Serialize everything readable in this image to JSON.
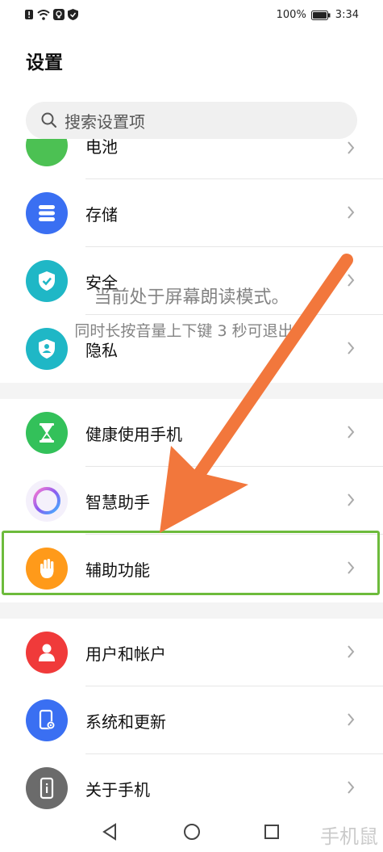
{
  "status_bar": {
    "battery": "100%",
    "time": "3:34"
  },
  "header": {
    "title": "设置"
  },
  "search": {
    "placeholder": "搜索设置项"
  },
  "items": [
    {
      "label": "电池",
      "color": "#4cc153"
    },
    {
      "label": "存储",
      "color": "#3a6ff2"
    },
    {
      "label": "安全",
      "color": "#1fb7c6"
    },
    {
      "label": "隐私",
      "color": "#1fb7c6"
    },
    {
      "label": "健康使用手机",
      "color": "#33c15a"
    },
    {
      "label": "智慧助手",
      "color": "#8a5cf0"
    },
    {
      "label": "辅助功能",
      "color": "#ff9a1a"
    },
    {
      "label": "用户和帐户",
      "color": "#f03a3a"
    },
    {
      "label": "系统和更新",
      "color": "#3a6ff2"
    },
    {
      "label": "关于手机",
      "color": "#6b6b6b"
    }
  ],
  "toast": {
    "line1": "当前处于屏幕朗读模式。",
    "line2": "同时长按音量上下键 3 秒可退出。"
  },
  "watermark": {
    "text": "手机鼠"
  },
  "highlight_color": "#6dbb3c",
  "arrow_color": "#f2773c"
}
